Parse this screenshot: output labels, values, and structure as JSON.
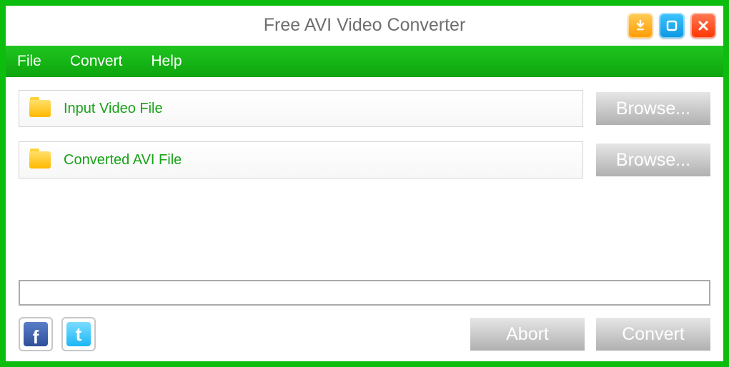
{
  "window": {
    "title": "Free AVI Video Converter"
  },
  "menubar": {
    "file": "File",
    "convert": "Convert",
    "help": "Help"
  },
  "fields": {
    "input_label": "Input Video File",
    "output_label": "Converted AVI File",
    "browse_label": "Browse..."
  },
  "actions": {
    "abort": "Abort",
    "convert": "Convert"
  },
  "social": {
    "facebook_glyph": "f",
    "twitter_glyph": "t"
  }
}
